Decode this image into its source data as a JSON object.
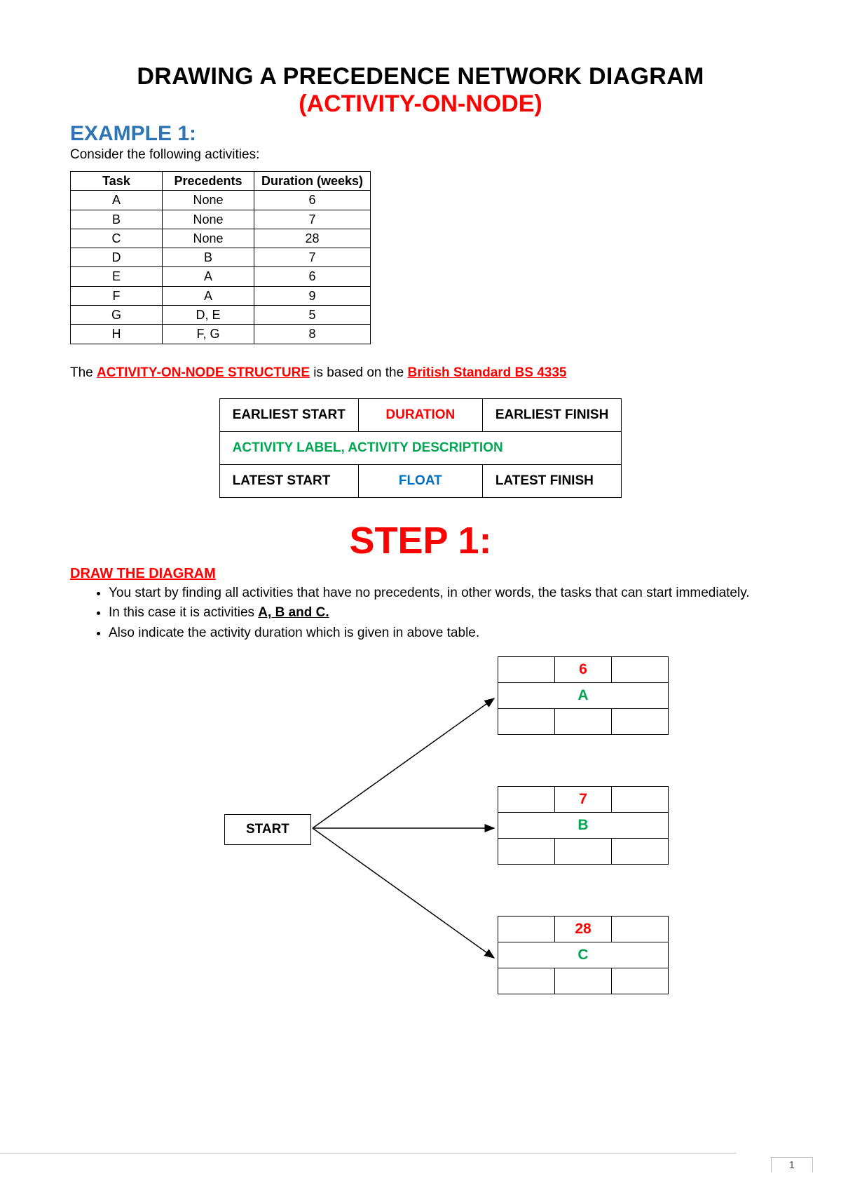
{
  "title_main": "DRAWING A PRECEDENCE NETWORK DIAGRAM",
  "title_sub": "(ACTIVITY-ON-NODE)",
  "example_heading": "EXAMPLE 1:",
  "intro_text": "Consider the following activities:",
  "table": {
    "headers": [
      "Task",
      "Precedents",
      "Duration (weeks)"
    ],
    "rows": [
      [
        "A",
        "None",
        "6"
      ],
      [
        "B",
        "None",
        "7"
      ],
      [
        "C",
        "None",
        "28"
      ],
      [
        "D",
        "B",
        "7"
      ],
      [
        "E",
        "A",
        "6"
      ],
      [
        "F",
        "A",
        "9"
      ],
      [
        "G",
        "D, E",
        "5"
      ],
      [
        "H",
        "F, G",
        "8"
      ]
    ]
  },
  "structure_line_pre": "The ",
  "structure_term": "ACTIVITY-ON-NODE STRUCTURE",
  "structure_line_mid": " is based on the ",
  "structure_standard": "British Standard BS 4335",
  "node_structure": {
    "earliest_start": "EARLIEST START",
    "duration": "DURATION",
    "earliest_finish": "EARLIEST FINISH",
    "middle": "ACTIVITY LABEL, ACTIVITY DESCRIPTION",
    "latest_start": "LATEST START",
    "float": "FLOAT",
    "latest_finish": "LATEST FINISH"
  },
  "step_heading": "STEP 1:",
  "draw_heading": "DRAW THE DIAGRAM",
  "bullets": {
    "b1": "You start by finding all activities that have no precedents, in other words, the tasks that can start immediately.",
    "b2_pre": "In this case it is activities ",
    "b2_bold": "A, B and C.",
    "b3": "Also indicate the activity duration which is given in above table."
  },
  "diagram": {
    "start_label": "START",
    "nodes": [
      {
        "duration": "6",
        "label": "A"
      },
      {
        "duration": "7",
        "label": "B"
      },
      {
        "duration": "28",
        "label": "C"
      }
    ]
  },
  "page_number": "1"
}
